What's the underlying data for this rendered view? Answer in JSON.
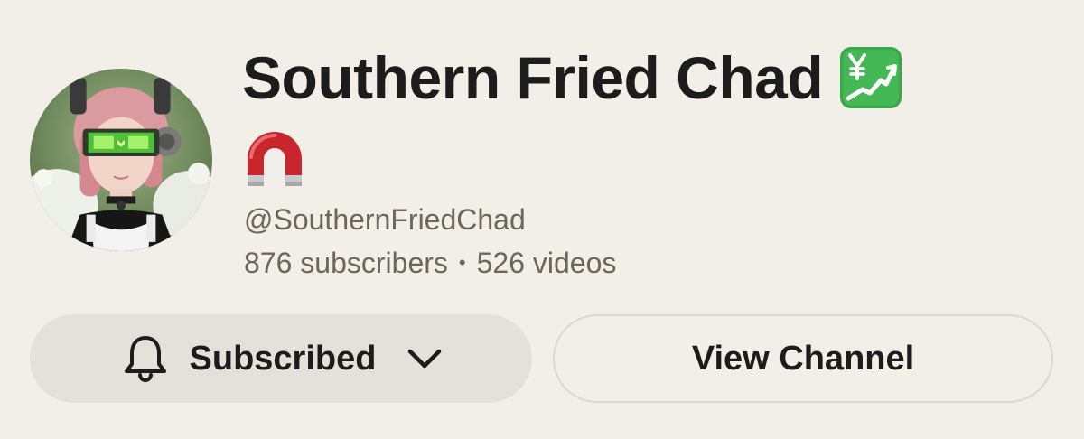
{
  "channel": {
    "name": "Southern Fried Chad",
    "badge_icon": "chart-increasing-with-yen-icon",
    "secondary_icon": "magnet-icon",
    "handle": "@SouthernFriedChad",
    "subscribers": "876 subscribers",
    "separator": "•",
    "videos": "526 videos"
  },
  "actions": {
    "subscribed_label": "Subscribed",
    "subscribed_icon": "bell-icon",
    "dropdown_icon": "chevron-down-icon",
    "view_channel_label": "View Channel"
  },
  "colors": {
    "background": "#f2efe8",
    "subscribed_button": "#e4e1da",
    "text_primary": "#1c1c1c",
    "text_secondary": "#6b6759",
    "badge_green": "#3aa84a",
    "magnet_red": "#c8262c"
  }
}
